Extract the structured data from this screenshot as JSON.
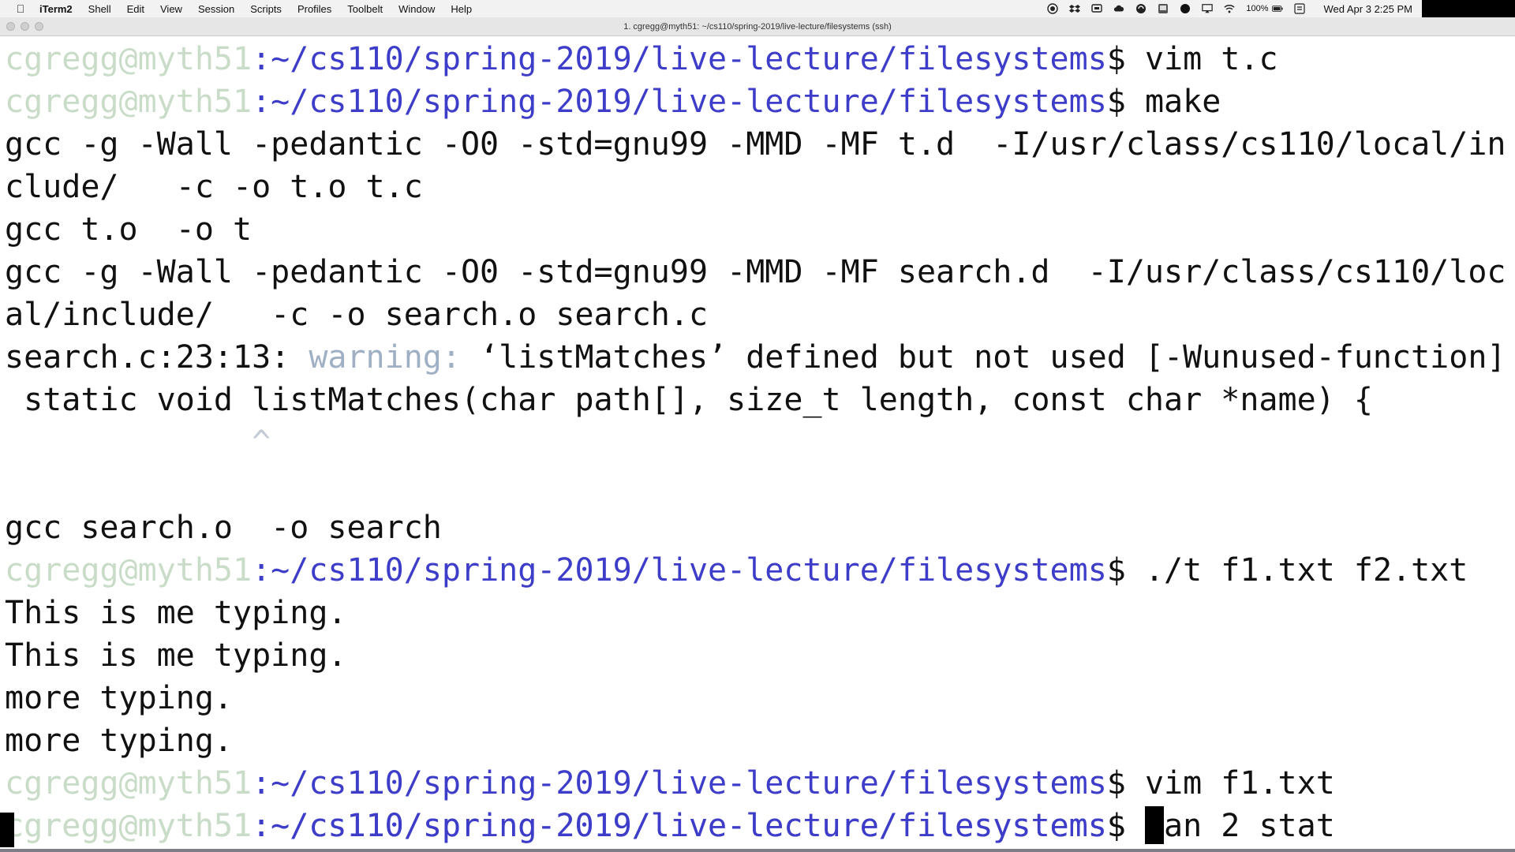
{
  "menubar": {
    "items": [
      "iTerm2",
      "Shell",
      "Edit",
      "View",
      "Session",
      "Scripts",
      "Profiles",
      "Toolbelt",
      "Window",
      "Help"
    ],
    "battery": "100%",
    "clock": "Wed Apr 3  2:25 PM"
  },
  "window": {
    "title": "1. cgregg@myth51: ~/cs110/spring-2019/live-lecture/filesystems (ssh)"
  },
  "prompt": {
    "user": "cgregg@myth51",
    "path": ":~/cs110/spring-2019/live-lecture/filesystems",
    "symbol": "$ "
  },
  "terminal": {
    "cmd1": "vim t.c",
    "cmd2": "make",
    "out1": "gcc -g -Wall -pedantic -O0 -std=gnu99 -MMD -MF t.d  -I/usr/class/cs110/local/in",
    "out2": "clude/   -c -o t.o t.c",
    "out3": "gcc t.o  -o t",
    "out4": "gcc -g -Wall -pedantic -O0 -std=gnu99 -MMD -MF search.d  -I/usr/class/cs110/loc",
    "out5": "al/include/   -c -o search.o search.c",
    "warn_loc": "search.c:23:13: ",
    "warn_word": "warning:",
    "warn_msg": " ‘listMatches’ defined but not used [-Wunused-function]",
    "out6": " static void listMatches(char path[], size_t length, const char *name) {",
    "out7": "             ^",
    "out8": "gcc search.o  -o search",
    "cmd3": "./t f1.txt f2.txt",
    "out9": "This is me typing.",
    "out10": "This is me typing.",
    "out11": "more typing.",
    "out12": "more typing.",
    "cmd4": "vim f1.txt",
    "cmd5": "man 2 stat"
  }
}
